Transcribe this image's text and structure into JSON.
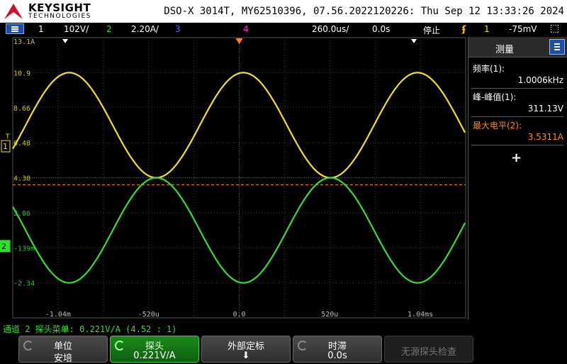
{
  "brand": {
    "name": "KEYSIGHT",
    "sub": "TECHNOLOGIES"
  },
  "scope_id": "DSO-X 3014T, MY62510396, 07.56.2022120226: Thu Sep 12 13:33:26 2024",
  "status": {
    "ch1_num": "1",
    "ch1_scale": "102V/",
    "ch2_num": "2",
    "ch2_scale": "2.20A/",
    "ch3_num": "3",
    "ch4_num": "4",
    "timebase": "260.0us/",
    "delay": "0.0s",
    "run_state": "停止",
    "trig_src": "1",
    "trig_level": "-75mV"
  },
  "colors": {
    "ch1": "#f0e020",
    "ch2": "#33dd33",
    "ch3": "#4a6cff",
    "ch4": "#ff33cc",
    "trigger": "#ff8a1a",
    "softkey_green": "#1c8a1c"
  },
  "grid": {
    "ch1_labels": [
      "13.1A",
      "10.9",
      "8.66",
      "6.48",
      "4.30"
    ],
    "ch2_labels": [
      "2.06",
      "-139m",
      "-2.34"
    ],
    "time_labels": [
      "-1.04m",
      "-520u",
      "0.0",
      "520u",
      "1.04ms"
    ],
    "ch1_marker": "1",
    "ch2_marker": "2",
    "trigger_marker": "T"
  },
  "measurements": {
    "title": "测量",
    "items": [
      {
        "label": "频率(1):",
        "value": "1.0006kHz",
        "color": "#ffffff"
      },
      {
        "label": "峰-峰值(1):",
        "value": "311.13V",
        "color": "#ffffff"
      },
      {
        "label": "最大电平(2):",
        "value": "3.5311A",
        "color": "#ff8a1a"
      }
    ],
    "add_label": "+"
  },
  "message": "通道 2 探头菜单: 0.221V/A (4.52 : 1)",
  "softkeys": [
    {
      "l1": "单位",
      "l2": "安培"
    },
    {
      "l1": "探头",
      "l2": "0.221V/A"
    },
    {
      "l1": "外部定标",
      "l2": "⬇"
    },
    {
      "l1": "时滞",
      "l2": "0.0s"
    },
    {
      "l1": "无源探头检查",
      "l2": ""
    }
  ],
  "back_icon": "↑",
  "waveforms": {
    "period_us": 1000,
    "ch1": {
      "center_div": 2.5,
      "amplitude_div": 1.5,
      "color_key": "ch1"
    },
    "ch2": {
      "center_div": 5.5,
      "amplitude_div": 1.5,
      "color_key": "ch2"
    }
  }
}
